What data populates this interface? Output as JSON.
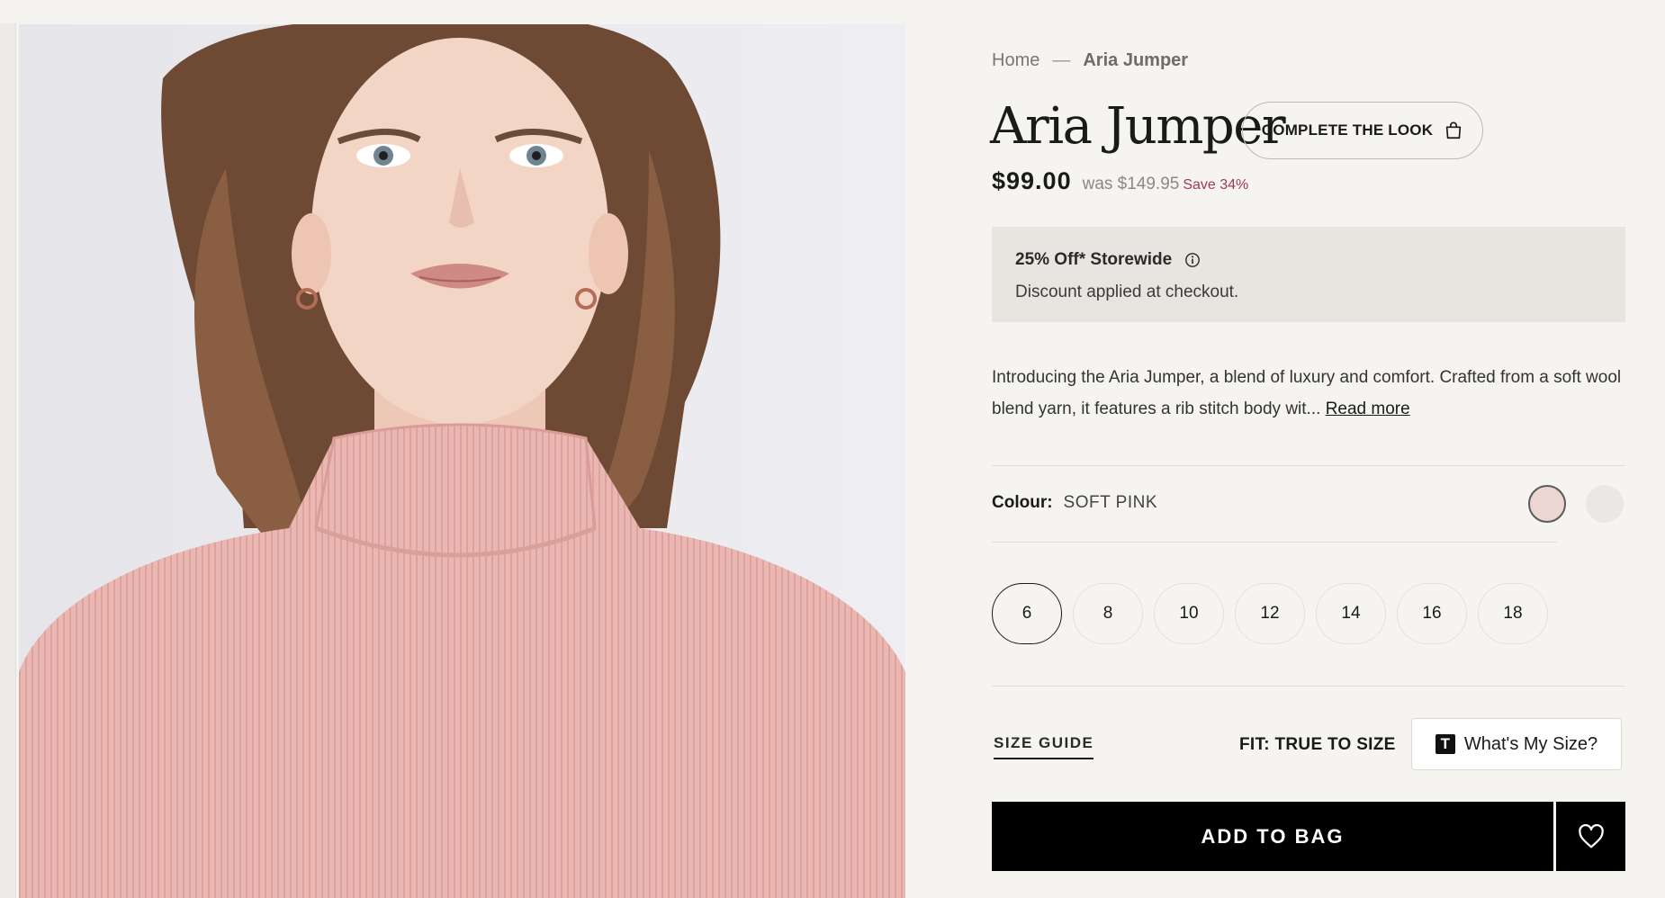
{
  "breadcrumb": {
    "home": "Home",
    "separator": "—",
    "current": "Aria Jumper"
  },
  "product": {
    "title": "Aria Jumper",
    "price": "$99.00",
    "was_price": "was $149.95",
    "save_label": "Save 34%"
  },
  "complete_look": {
    "label": "COMPLETE THE LOOK",
    "icon": "shopping-bag-icon"
  },
  "promo": {
    "title": "25% Off* Storewide",
    "subtitle": "Discount applied at checkout.",
    "icon": "info-icon"
  },
  "description": {
    "text": "Introducing the Aria Jumper, a blend of luxury and comfort. Crafted from a soft wool blend yarn, it features a rib stitch body wit...",
    "read_more": "Read more"
  },
  "colour": {
    "label": "Colour:",
    "selected": "SOFT PINK",
    "swatches": [
      {
        "name": "soft-pink",
        "color": "#ecd6d3",
        "selected": true
      },
      {
        "name": "light-grey",
        "color": "#ebe7e5",
        "selected": false
      }
    ]
  },
  "sizes": {
    "options": [
      "6",
      "8",
      "10",
      "12",
      "14",
      "16",
      "18"
    ],
    "selected": "6"
  },
  "size_guide": "SIZE GUIDE",
  "fit": "FIT: TRUE TO SIZE",
  "whats_my_size": {
    "label": "What's My Size?",
    "logo_letter": "T"
  },
  "add_to_bag": "ADD TO BAG",
  "colors": {
    "accent_sale": "#9b3b55",
    "button_bg": "#000000",
    "promo_bg": "#e8e5e0",
    "page_bg": "#f6f4f0"
  }
}
